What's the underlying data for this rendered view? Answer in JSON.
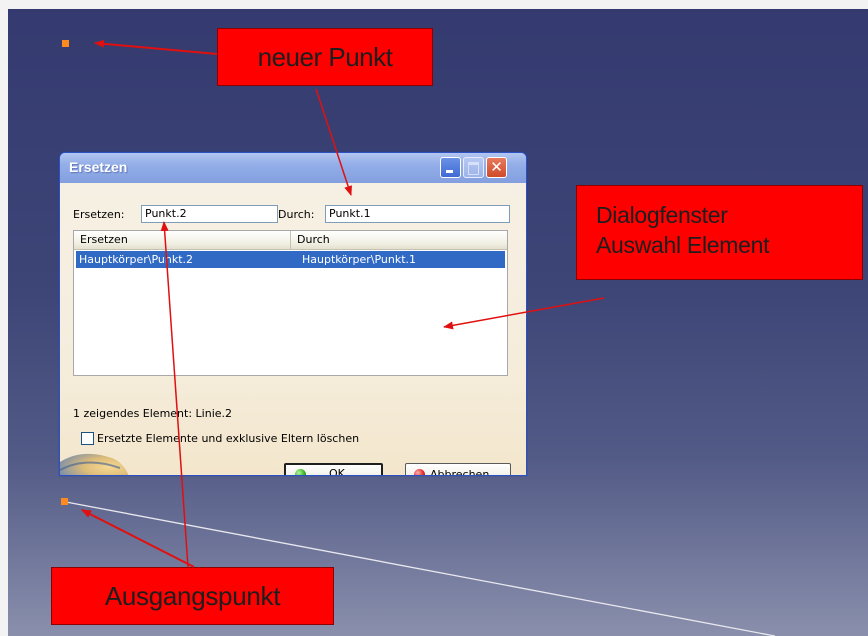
{
  "callouts": {
    "new_point": "neuer Punkt",
    "dialog_line1": "Dialogfenster",
    "dialog_line2": "Auswahl Element",
    "origin_point": "Ausgangspunkt"
  },
  "dialog": {
    "title": "Ersetzen",
    "replace_label": "Ersetzen:",
    "replace_value": "Punkt.2",
    "with_label": "Durch:",
    "with_value": "Punkt.1",
    "columns": [
      "Ersetzen",
      "Durch"
    ],
    "rows": [
      {
        "replace": "Hauptkörper\\Punkt.2",
        "with": "Hauptkörper\\Punkt.1"
      }
    ],
    "pointing_element": "1 zeigendes Element: Linie.2",
    "checkbox_label": "Ersetzte Elemente und exklusive Eltern löschen",
    "checkbox_checked": false,
    "ok_label": "OK",
    "cancel_label": "Abbrechen",
    "close_glyph": "✕"
  },
  "colors": {
    "callout": "#ff0000",
    "point": "#ff8a1f",
    "selection": "#316ac5",
    "arrow": "#e01010"
  },
  "icons": {
    "ok": "green-sphere-icon",
    "cancel": "red-sphere-icon",
    "logo": "globe-logo-icon"
  }
}
